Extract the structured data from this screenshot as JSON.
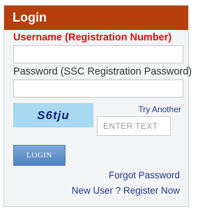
{
  "header": {
    "title": "Login"
  },
  "form": {
    "username_label": "Username (Registration Number)",
    "username_value": "",
    "password_label": "Password (SSC Registration Password)",
    "password_value": "",
    "captcha_text": "S6tju",
    "try_another": "Try Another",
    "captcha_placeholder": "ENTER TEXT",
    "login_button": "LOGIN"
  },
  "links": {
    "forgot_password": "Forgot Password",
    "register": "New User ? Register Now"
  },
  "colors": {
    "header_bg": "#b5400e",
    "required_label": "#e11010",
    "link": "#1c3a8c",
    "captcha_bg": "#a9d8f1",
    "button": "#5e8dc9"
  }
}
